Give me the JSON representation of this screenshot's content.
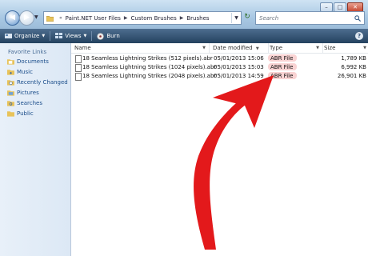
{
  "address_bar": {
    "crumbs": [
      "Paint.NET User Files",
      "Custom Brushes",
      "Brushes"
    ]
  },
  "search": {
    "placeholder": "Search"
  },
  "toolbar": {
    "organize": "Organize",
    "views": "Views",
    "burn": "Burn"
  },
  "nav_pane": {
    "header": "Favorite Links",
    "items": [
      "Documents",
      "Music",
      "Recently Changed",
      "Pictures",
      "Searches",
      "Public"
    ]
  },
  "columns": {
    "name": "Name",
    "date_modified": "Date modified",
    "type": "Type",
    "size": "Size"
  },
  "files": [
    {
      "name": "18 Seamless Lightning Strikes (512 pixels).abr",
      "date": "05/01/2013 15:06",
      "type": "ABR File",
      "size": "1,789 KB"
    },
    {
      "name": "18 Seamless Lightning Strikes (1024 pixels).abr",
      "date": "05/01/2013 15:03",
      "type": "ABR File",
      "size": "6,992 KB"
    },
    {
      "name": "18 Seamless Lightning Strikes (2048 pixels).abr",
      "date": "05/01/2013 14:59",
      "type": "ABR File",
      "size": "26,901 KB"
    }
  ],
  "colors": {
    "arrow": "#e3191b",
    "toolbar": "#2f4f70",
    "link": "#1a4d8a"
  }
}
